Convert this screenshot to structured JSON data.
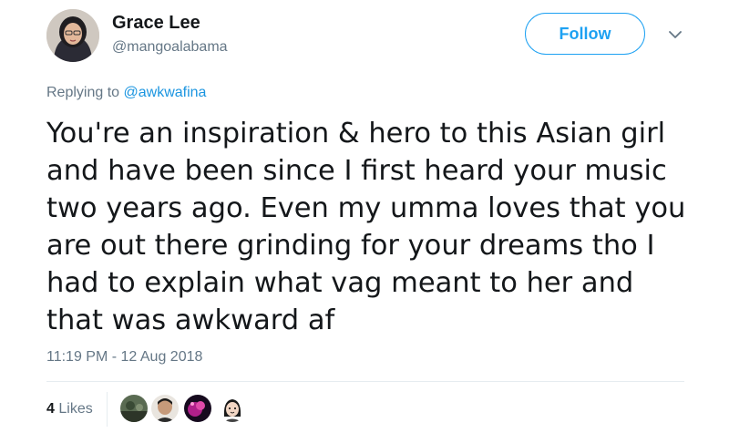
{
  "author": {
    "display_name": "Grace Lee",
    "handle": "@mangoalabama",
    "avatar_icon": "user-avatar-photo"
  },
  "follow_button": {
    "label": "Follow",
    "color": "#1da1f2"
  },
  "menu": {
    "icon": "chevron-down-icon"
  },
  "reply_context": {
    "prefix": "Replying to",
    "mention": "@awkwafina",
    "mention_color": "#1b95e0"
  },
  "tweet": {
    "text_lines": [
      "You're an inspiration & hero to this Asian girl",
      "and have been since I first heard your music",
      "two years ago. Even my umma loves that you",
      "are out there grinding for your dreams tho I",
      "had to explain what vag meant to her and",
      "that was awkward af"
    ],
    "timestamp": "11:19 PM - 12 Aug 2018"
  },
  "stats": {
    "likes_count": "4",
    "likes_label": "Likes",
    "likers": [
      "liker-avatar-1",
      "liker-avatar-2",
      "liker-avatar-3",
      "liker-avatar-4"
    ]
  }
}
